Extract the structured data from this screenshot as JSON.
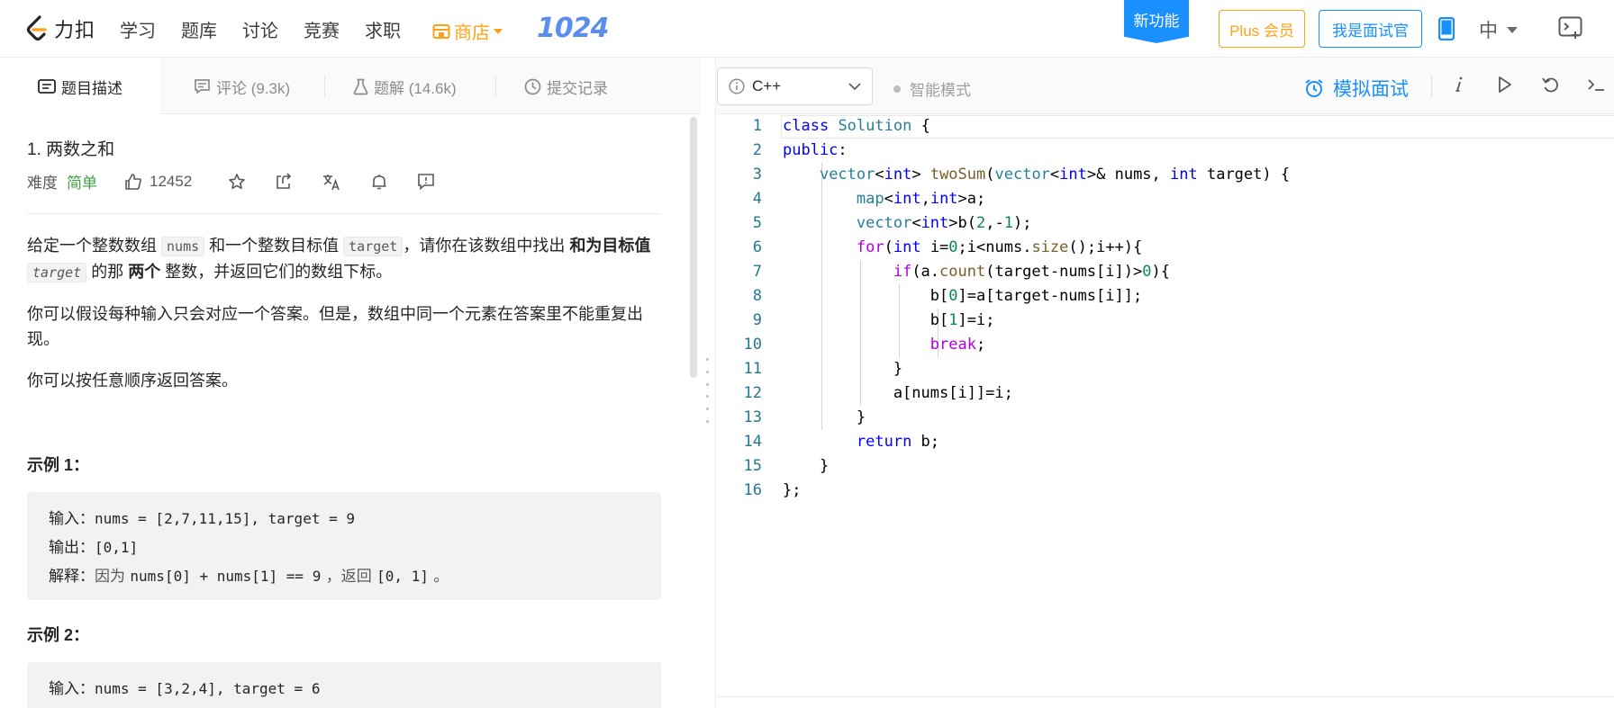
{
  "nav": {
    "logo_text": "力扣",
    "links": [
      "学习",
      "题库",
      "讨论",
      "竞赛",
      "求职"
    ],
    "store": "商店",
    "event_badge": "1024",
    "new_feature": "新功能",
    "plus": "Plus 会员",
    "interviewer": "我是面试官",
    "language": "中"
  },
  "left_tabs": [
    {
      "label": "题目描述",
      "icon": "description-icon"
    },
    {
      "label": "评论 (9.3k)",
      "icon": "comment-icon"
    },
    {
      "label": "题解 (14.6k)",
      "icon": "flask-icon"
    },
    {
      "label": "提交记录",
      "icon": "clock-icon"
    }
  ],
  "problem": {
    "title": "1. 两数之和",
    "difficulty_label": "难度",
    "difficulty": "简单",
    "likes": "12452",
    "desc": {
      "p1_a": "给定一个整数数组 ",
      "p1_code1": "nums",
      "p1_b": " 和一个整数目标值 ",
      "p1_code2": "target",
      "p1_c": "，请你在该数组中找出 ",
      "p1_bold1": "和为目标值",
      "p1_code3": "target",
      "p1_d": " 的那 ",
      "p1_bold2": "两个",
      "p1_e": " 整数，并返回它们的数组下标。",
      "p2": "你可以假设每种输入只会对应一个答案。但是，数组中同一个元素在答案里不能重复出现。",
      "p3": "你可以按任意顺序返回答案。"
    },
    "examples": [
      {
        "title": "示例 1：",
        "input_label": "输入：",
        "input": "nums = [2,7,11,15], target = 9",
        "output_label": "输出：",
        "output": "[0,1]",
        "explain_label": "解释：",
        "explain_a": "因为 ",
        "explain_b": "nums[0] + nums[1] == 9",
        "explain_c": " ，返回 ",
        "explain_d": "[0, 1]",
        "explain_e": " 。"
      },
      {
        "title": "示例 2：",
        "input_label": "输入：",
        "input": "nums = [3,2,4], target = 6"
      }
    ]
  },
  "editor_bar": {
    "language": "C++",
    "smart_mode": "智能模式",
    "mock_interview": "模拟面试"
  },
  "code_lines": [
    "class Solution {",
    "public:",
    "    vector<int> twoSum(vector<int>& nums, int target) {",
    "        map<int,int>a;",
    "        vector<int>b(2,-1);",
    "        for(int i=0;i<nums.size();i++){",
    "            if(a.count(target-nums[i])>0){",
    "                b[0]=a[target-nums[i]];",
    "                b[1]=i;",
    "                break;",
    "            }",
    "            a[nums[i]]=i;",
    "        }",
    "        return b;",
    "    }",
    "};"
  ],
  "line_numbers": [
    "1",
    "2",
    "3",
    "4",
    "5",
    "6",
    "7",
    "8",
    "9",
    "10",
    "11",
    "12",
    "13",
    "14",
    "15",
    "16"
  ]
}
